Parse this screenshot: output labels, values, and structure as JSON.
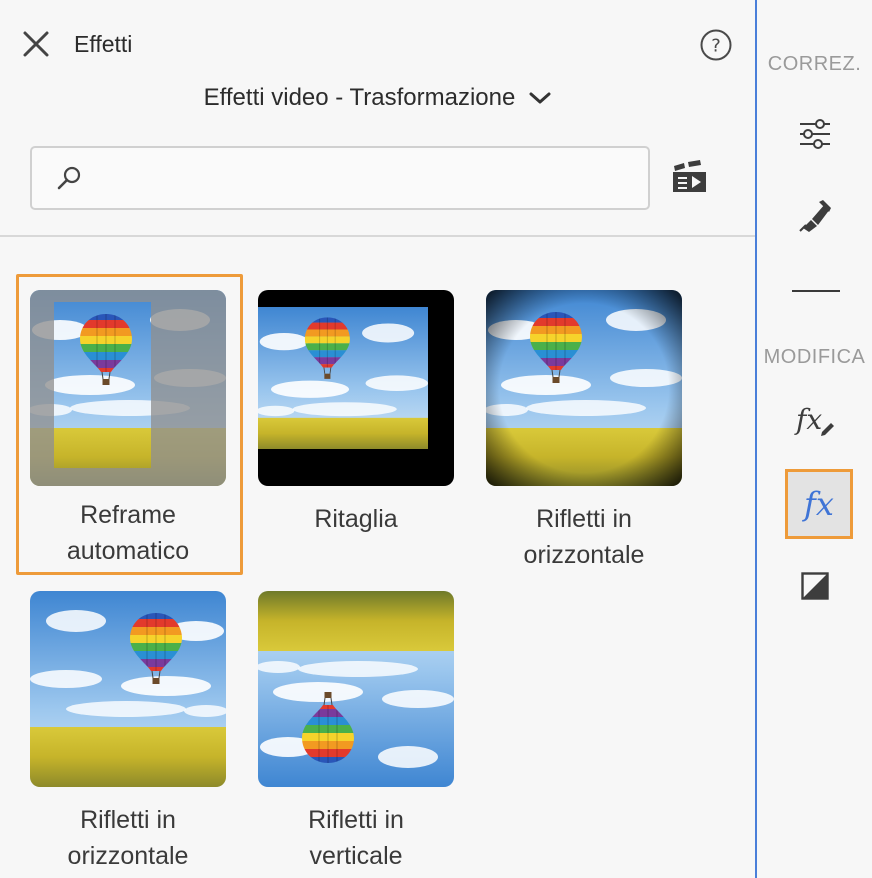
{
  "panel": {
    "title": "Effetti",
    "category": "Effetti video - Trasformazione",
    "search_placeholder": "",
    "help_symbol": "?"
  },
  "effects": [
    {
      "label_line1": "Reframe",
      "label_line2": "automatico",
      "selected": true
    },
    {
      "label_line1": "Ritaglia",
      "label_line2": "",
      "selected": false
    },
    {
      "label_line1": "Rifletti in",
      "label_line2": "orizzontale",
      "selected": false
    },
    {
      "label_line1": "Rifletti in",
      "label_line2": "orizzontale",
      "selected": false
    },
    {
      "label_line1": "Rifletti in",
      "label_line2": "verticale",
      "selected": false
    }
  ],
  "rail": {
    "section_correct": "CORREZ.",
    "section_edit": "MODIFICA",
    "fx_label": "fx",
    "items": [
      {
        "icon": "sliders-icon"
      },
      {
        "icon": "heal-brush-icon"
      },
      {
        "icon": "fx-pencil-icon"
      },
      {
        "icon": "fx-icon",
        "active": true
      },
      {
        "icon": "contrast-square-icon"
      }
    ]
  },
  "colors": {
    "accent_orange": "#ee9b3a",
    "active_blue": "#3f74d6",
    "divider_blue": "#4a7fd9"
  }
}
